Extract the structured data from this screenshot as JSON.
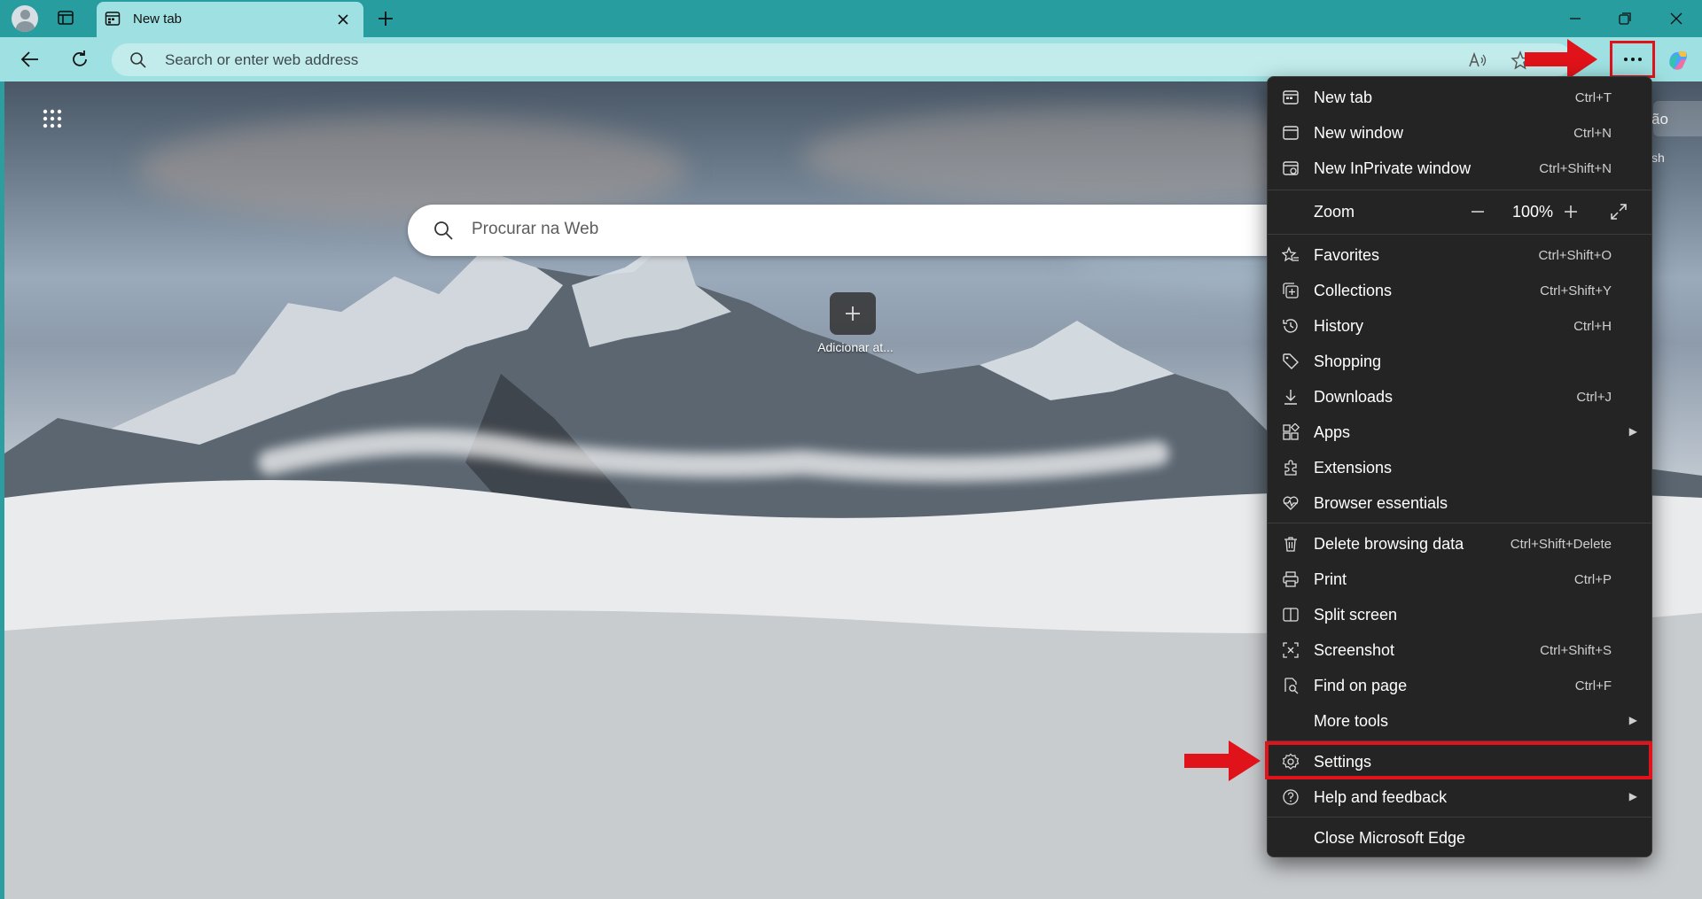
{
  "tab": {
    "title": "New tab"
  },
  "addressbar": {
    "placeholder": "Search or enter web address"
  },
  "newtab_page": {
    "search_placeholder": "Procurar na Web",
    "add_site_label": "Adicionar at...",
    "right_peek_1": "ão",
    "right_peek_2": "sh"
  },
  "menu": {
    "items": [
      {
        "label": "New tab",
        "shortcut": "Ctrl+T",
        "icon": "new-tab-icon"
      },
      {
        "label": "New window",
        "shortcut": "Ctrl+N",
        "icon": "window-icon"
      },
      {
        "label": "New InPrivate window",
        "shortcut": "Ctrl+Shift+N",
        "icon": "inprivate-icon"
      },
      {
        "label": "Zoom",
        "value": "100%"
      },
      {
        "label": "Favorites",
        "shortcut": "Ctrl+Shift+O",
        "icon": "favorites-icon"
      },
      {
        "label": "Collections",
        "shortcut": "Ctrl+Shift+Y",
        "icon": "collections-icon"
      },
      {
        "label": "History",
        "shortcut": "Ctrl+H",
        "icon": "history-icon"
      },
      {
        "label": "Shopping",
        "shortcut": "",
        "icon": "shopping-tag-icon"
      },
      {
        "label": "Downloads",
        "shortcut": "Ctrl+J",
        "icon": "download-icon"
      },
      {
        "label": "Apps",
        "shortcut": "",
        "icon": "apps-icon"
      },
      {
        "label": "Extensions",
        "shortcut": "",
        "icon": "extensions-icon"
      },
      {
        "label": "Browser essentials",
        "shortcut": "",
        "icon": "heart-pulse-icon"
      },
      {
        "label": "Delete browsing data",
        "shortcut": "Ctrl+Shift+Delete",
        "icon": "trash-icon"
      },
      {
        "label": "Print",
        "shortcut": "Ctrl+P",
        "icon": "print-icon"
      },
      {
        "label": "Split screen",
        "shortcut": "",
        "icon": "split-screen-icon"
      },
      {
        "label": "Screenshot",
        "shortcut": "Ctrl+Shift+S",
        "icon": "screenshot-icon"
      },
      {
        "label": "Find on page",
        "shortcut": "Ctrl+F",
        "icon": "find-icon"
      },
      {
        "label": "More tools",
        "shortcut": ""
      },
      {
        "label": "Settings",
        "shortcut": "",
        "icon": "gear-icon"
      },
      {
        "label": "Help and feedback",
        "shortcut": "",
        "icon": "help-icon"
      },
      {
        "label": "Close Microsoft Edge",
        "shortcut": ""
      }
    ]
  },
  "colors": {
    "accent_teal": "#279da0",
    "annotation_red": "#e0131a",
    "menu_bg": "#242424"
  }
}
